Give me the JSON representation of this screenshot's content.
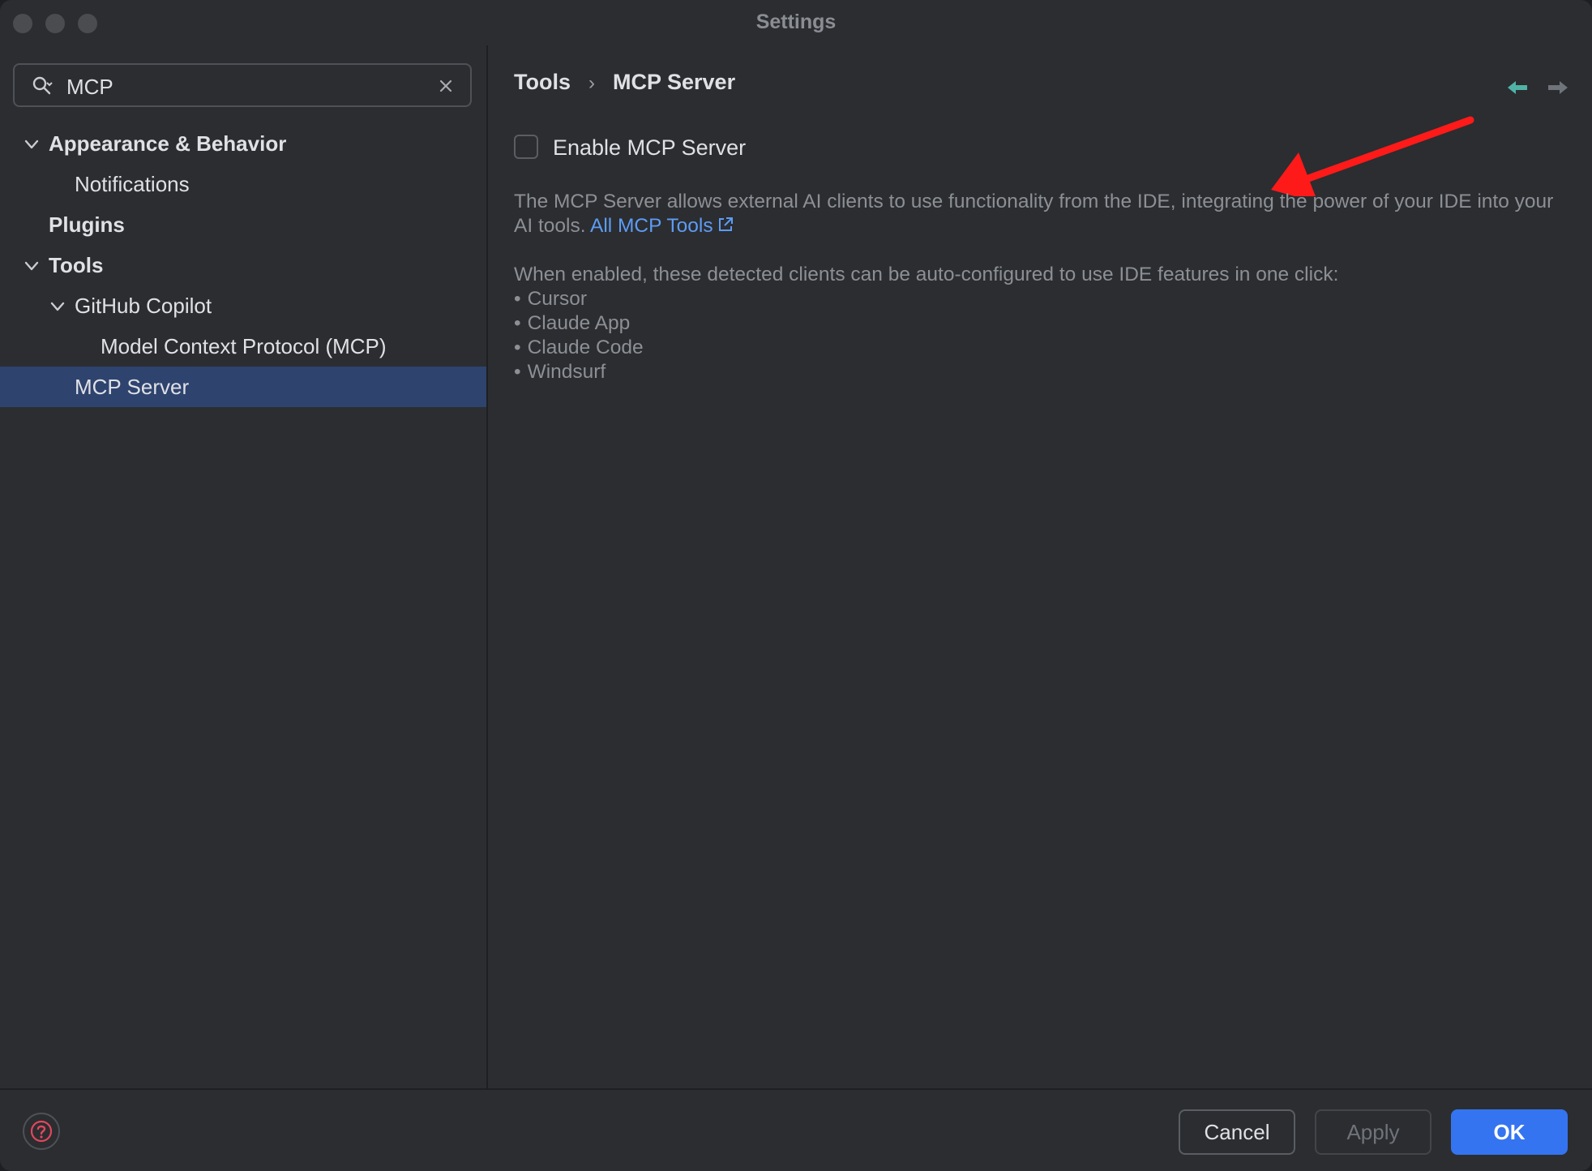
{
  "window": {
    "title": "Settings"
  },
  "search": {
    "value": "MCP",
    "icon": "search-icon",
    "clear_icon": "close-icon"
  },
  "sidebar": {
    "items": [
      {
        "label": "Appearance & Behavior",
        "expanded": true,
        "bold": true
      },
      {
        "label": "Notifications"
      },
      {
        "label": "Plugins",
        "bold": true
      },
      {
        "label": "Tools",
        "expanded": true,
        "bold": true
      },
      {
        "label": "GitHub Copilot",
        "expanded": true
      },
      {
        "label": "Model Context Protocol (MCP)"
      },
      {
        "label": "MCP Server",
        "selected": true
      }
    ]
  },
  "main": {
    "breadcrumb": [
      "Tools",
      "MCP Server"
    ],
    "breadcrumb_separator": "›",
    "enable_checkbox": {
      "label": "Enable MCP Server",
      "checked": false
    },
    "description_text": "The MCP Server allows external AI clients to use functionality from the IDE, integrating the power of your IDE into your AI tools.",
    "description_link": "All MCP Tools",
    "clients_intro": "When enabled, these detected clients can be auto-configured to use IDE features in one click:",
    "clients": [
      "Cursor",
      "Claude App",
      "Claude Code",
      "Windsurf"
    ]
  },
  "footer": {
    "cancel_label": "Cancel",
    "apply_label": "Apply",
    "ok_label": "OK"
  },
  "colors": {
    "background": "#2b2d30",
    "selected": "#2e436e",
    "accent": "#3574f0",
    "link": "#5d9cf5",
    "annotation_arrow": "#ff1a1a",
    "nav_back": "#4fb3a6"
  }
}
